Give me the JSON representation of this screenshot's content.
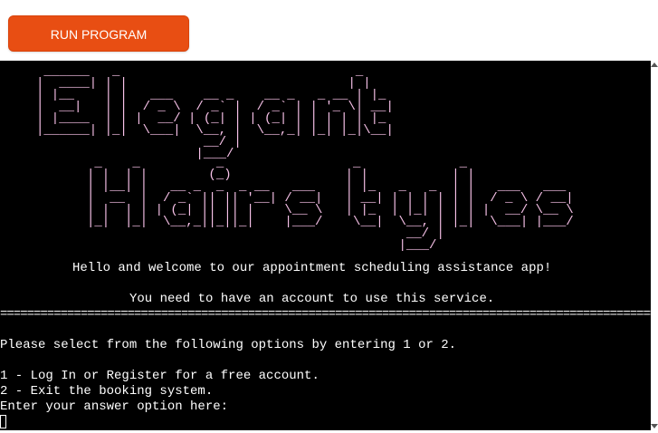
{
  "toolbar": {
    "run_label": "RUN PROGRAM"
  },
  "terminal": {
    "banner_line1": " ______   _                               _   \n|  ____| | |                             | |  \n| |__    | |   ___    __ _    __ _   _ __ | |_ \n|  __|   | |  / _ \\  / _` |  / _` | | '_ \\| __|\n| |____  | | |  __/ | (_| | | (_| | | | | | |_ \n|______| |_|  \\___|  \\__, |  \\__,_| |_| |_|\\__|\n                      __/ |                   \n                     |___/                    ",
    "banner_line2": " _    _          _                 _             _              \n| |  | |        (_)               | |           | |             \n| |__| |   __ _  _  _ __   ___    | |_   _   _  | |   ___   ___ \n|  __  |  / _` || || '__| / __|   | __| | | | | | |  / _ \\ / __|\n| |  | | | (_| || || |    \\__ \\   | |_  | |_| | | | |  __/ \\__ \\\n|_|  |_|  \\__,_||_||_|    |___/    \\__|  \\__, | |_|  \\___| |___/\n                                          __/ |                 \n                                         |___/                  ",
    "welcome": "Hello and welcome to our appointment scheduling assistance app!",
    "account_notice": "You need to have an account to use this service.",
    "divider": "==========================================================================================================",
    "select_prompt": "Please select from the following options by entering 1 or 2.",
    "options": [
      "1 - Log In or Register for a free account.",
      "2 - Exit the booking system."
    ],
    "input_prompt": "Enter your answer option here:"
  },
  "colors": {
    "button_bg": "#e84e13",
    "terminal_bg": "#000000",
    "banner_text": "#f7c1e8",
    "terminal_text": "#ffffff"
  }
}
